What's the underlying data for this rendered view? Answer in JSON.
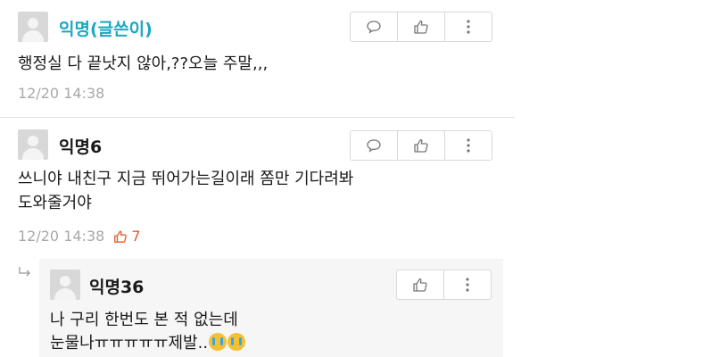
{
  "comments": [
    {
      "name": "익명(글쓴이)",
      "text": [
        "행정실 다 끝낫지 않아,??오늘 주말,,,"
      ],
      "time": "12/20 14:38",
      "likes": null
    },
    {
      "name": "익명6",
      "text": [
        "쓰니야 내친구 지금 뛰어가는길이래 쫌만 기다려봐",
        "도와줄거야"
      ],
      "time": "12/20 14:38",
      "likes": "7"
    }
  ],
  "reply": {
    "name": "익명36",
    "line1": "나 구리 한번도 본 적 없는데",
    "line2": "눈물나ㅠㅠㅠㅠㅠ제발..",
    "emoji": "crying-face"
  },
  "colors": {
    "author": "#1aa9c0",
    "likes": "#e65a2a",
    "meta": "#a8a8a8"
  },
  "icons": [
    "comment-icon",
    "thumbs-up-icon",
    "more-icon",
    "reply-arrow-icon"
  ]
}
